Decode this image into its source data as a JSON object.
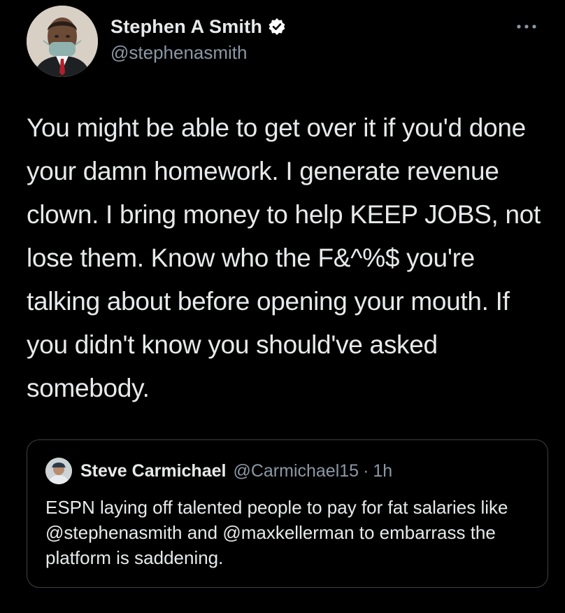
{
  "theme": {
    "background": "#000000",
    "text_primary": "#e7e9ea",
    "text_secondary": "#8b98a5",
    "verified_badge": "#ffffff",
    "border": "#3b4148"
  },
  "tweet": {
    "author": {
      "display_name": "Stephen A Smith",
      "handle": "@stephenasmith",
      "verified": true,
      "avatar_icon": "profile-photo"
    },
    "more_icon": "more-options-icon",
    "text": "You might be able to get over it if you'd done your damn homework. I generate revenue clown. I bring money to help KEEP JOBS, not lose them. Know who the F&^%$ you're talking about before opening your mouth. If you didn't know you should've asked somebody."
  },
  "quoted_tweet": {
    "author": {
      "display_name": "Steve Carmichael",
      "handle": "@Carmichael15",
      "avatar_icon": "profile-photo"
    },
    "separator": "·",
    "time": "1h",
    "text": "ESPN laying off talented people to pay for fat salaries like @stephenasmith and @maxkellerman to embarrass the platform is saddening."
  }
}
